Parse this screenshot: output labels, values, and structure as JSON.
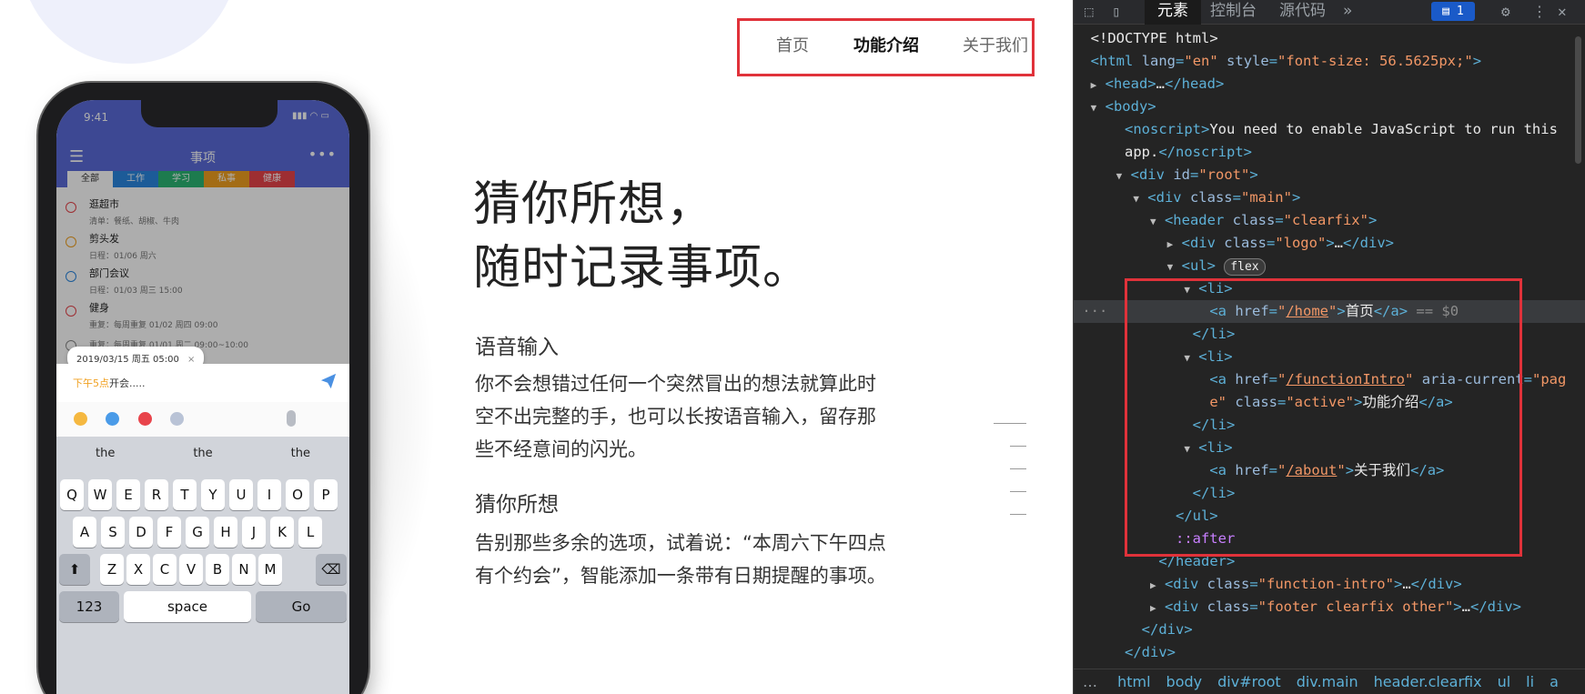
{
  "site": {
    "nav": {
      "home": "首页",
      "intro": "功能介绍",
      "about": "关于我们"
    },
    "hero": {
      "line1": "猜你所想，",
      "line2": "随时记录事项。"
    },
    "features": [
      {
        "title": "语音输入",
        "desc": "你不会想错过任何一个突然冒出的想法就算此时空不出完整的手，也可以长按语音输入，留存那些不经意间的闪光。"
      },
      {
        "title": "猜你所想",
        "desc": "告别那些多余的选项，试着说：“本周六下午四点有个约会”，智能添加一条带有日期提醒的事项。"
      }
    ],
    "phone": {
      "time": "9:41",
      "app_title": "事项",
      "tabs": [
        "全部",
        "工作",
        "学习",
        "私事",
        "健康"
      ],
      "tab_colors": [
        "#ffffff",
        "#2a86e0",
        "#2bb673",
        "#f0a020",
        "#e8444b"
      ],
      "items": [
        {
          "title": "逛超市",
          "sub": "清单：餐纸、胡椒、牛肉",
          "color": "#e8444b"
        },
        {
          "title": "剪头发",
          "sub": "日程：01/06 周六",
          "color": "#f0a020"
        },
        {
          "title": "部门会议",
          "sub": "日程：01/03 周三 15:00",
          "color": "#2a86e0"
        },
        {
          "title": "健身",
          "sub": "重复：每周重复 01/02 周四 09:00",
          "color": "#e8444b"
        },
        {
          "title": "",
          "sub": "重复：每周重复 01/01 周二 09:00~10:00",
          "color": "#888888"
        }
      ],
      "date_chip": "2019/03/15 周五 05:00",
      "date_chip_close": "×",
      "compose_highlight": "下午5点",
      "compose_rest": "开会.....",
      "suggestions": [
        "the",
        "the",
        "the"
      ],
      "row1": [
        "Q",
        "W",
        "E",
        "R",
        "T",
        "Y",
        "U",
        "I",
        "O",
        "P"
      ],
      "row2": [
        "A",
        "S",
        "D",
        "F",
        "G",
        "H",
        "J",
        "K",
        "L"
      ],
      "row3": [
        "Z",
        "X",
        "C",
        "V",
        "B",
        "N",
        "M"
      ],
      "key_123": "123",
      "key_space": "space",
      "key_go": "Go",
      "key_shift": "⬆",
      "key_backspace": "⌫"
    }
  },
  "devtools": {
    "tabs": {
      "elements": "元素",
      "console": "控制台",
      "sources": "源代码",
      "more": "»"
    },
    "issues_count": "1",
    "lines": [
      "<!DOCTYPE html>",
      "noscript_text_1",
      "noscript_text_2"
    ],
    "noscript_1": "You need to enable JavaScript to run this",
    "noscript_2": "app.",
    "home_href": "/home",
    "home_text": "首页",
    "intro_href": "/functionIntro",
    "intro_text": "功能介绍",
    "about_href": "/about",
    "about_text": "关于我们",
    "selected_marker": "== $0",
    "breadcrumbs": [
      "html",
      "body",
      "div#root",
      "div.main",
      "header.clearfix",
      "ul",
      "li",
      "a"
    ],
    "flex_badge": "flex"
  }
}
